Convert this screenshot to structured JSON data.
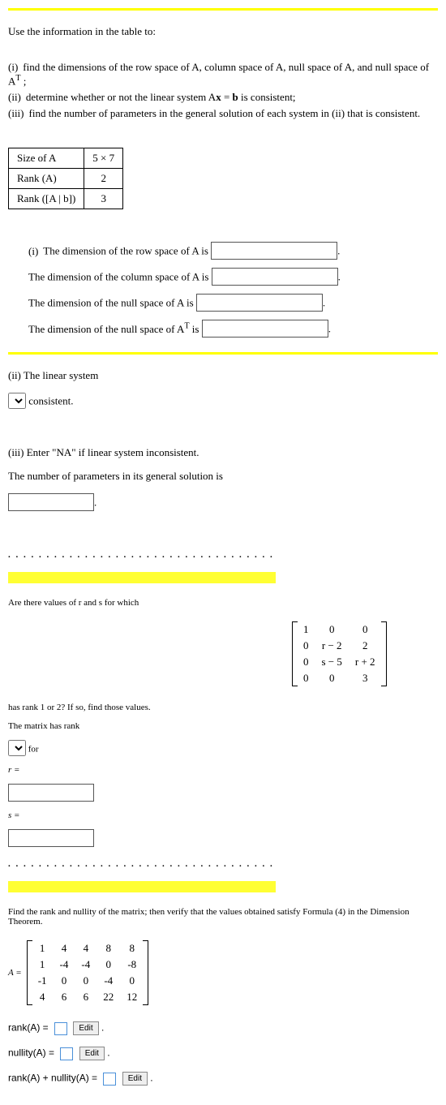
{
  "intro": {
    "lead": "Use the information in the table to:",
    "i": "find the dimensions of the row space of A, column space of A, null space of A, and null space of A",
    "i_tail": " ;",
    "ii_a": "determine whether or not the linear system A",
    "ii_b": " = ",
    "ii_c": " is consistent;",
    "iii": "find the number of parameters in the general solution of each system in (ii) that is consistent."
  },
  "table": {
    "r1c1": "Size of A",
    "r1c2": "5 × 7",
    "r2c1": "Rank (A)",
    "r2c2": "2",
    "r3c1": "Rank ([A | b])",
    "r3c2": "3"
  },
  "q1": {
    "marker": "(i)",
    "a": "The dimension of the row space of A is",
    "b": "The dimension of the column space of A is",
    "c": "The dimension of the null space of A is",
    "d_a": "The dimension of the null space of A",
    "d_b": " is"
  },
  "q2": {
    "heading": "(ii) The linear system",
    "tail": "consistent."
  },
  "q3": {
    "heading": "(iii) Enter \"NA\" if linear system inconsistent.",
    "line": "The number of parameters in its general solution is"
  },
  "p2": {
    "lead": "Are there values of r and s for which",
    "mat": [
      [
        "1",
        "0",
        "0"
      ],
      [
        "0",
        "r − 2",
        "2"
      ],
      [
        "0",
        "s − 5",
        "r + 2"
      ],
      [
        "0",
        "0",
        "3"
      ]
    ],
    "q": "has rank 1 or 2? If so, find those values.",
    "line": "The matrix has rank",
    "for": "for",
    "r": "r =",
    "s": "s ="
  },
  "p3": {
    "lead": "Find the rank and nullity of the matrix; then verify that the values obtained satisfy Formula (4) in the Dimension Theorem.",
    "Aeq": "A =",
    "mat": [
      [
        "1",
        "4",
        "4",
        "8",
        "8"
      ],
      [
        "1",
        "-4",
        "-4",
        "0",
        "-8"
      ],
      [
        "-1",
        "0",
        "0",
        "-4",
        "0"
      ],
      [
        "4",
        "6",
        "6",
        "22",
        "12"
      ]
    ],
    "rank": "rank(A) =",
    "nullity": "nullity(A) =",
    "sum": "rank(A) + nullity(A) =",
    "edit": "Edit"
  },
  "sym": {
    "x": "x",
    "b": "b",
    "T": "T"
  },
  "dots": ". . . . . . . . . . . . . . . . . . . . . . . . . . . . . . . . . . . . . . . . . . . ."
}
